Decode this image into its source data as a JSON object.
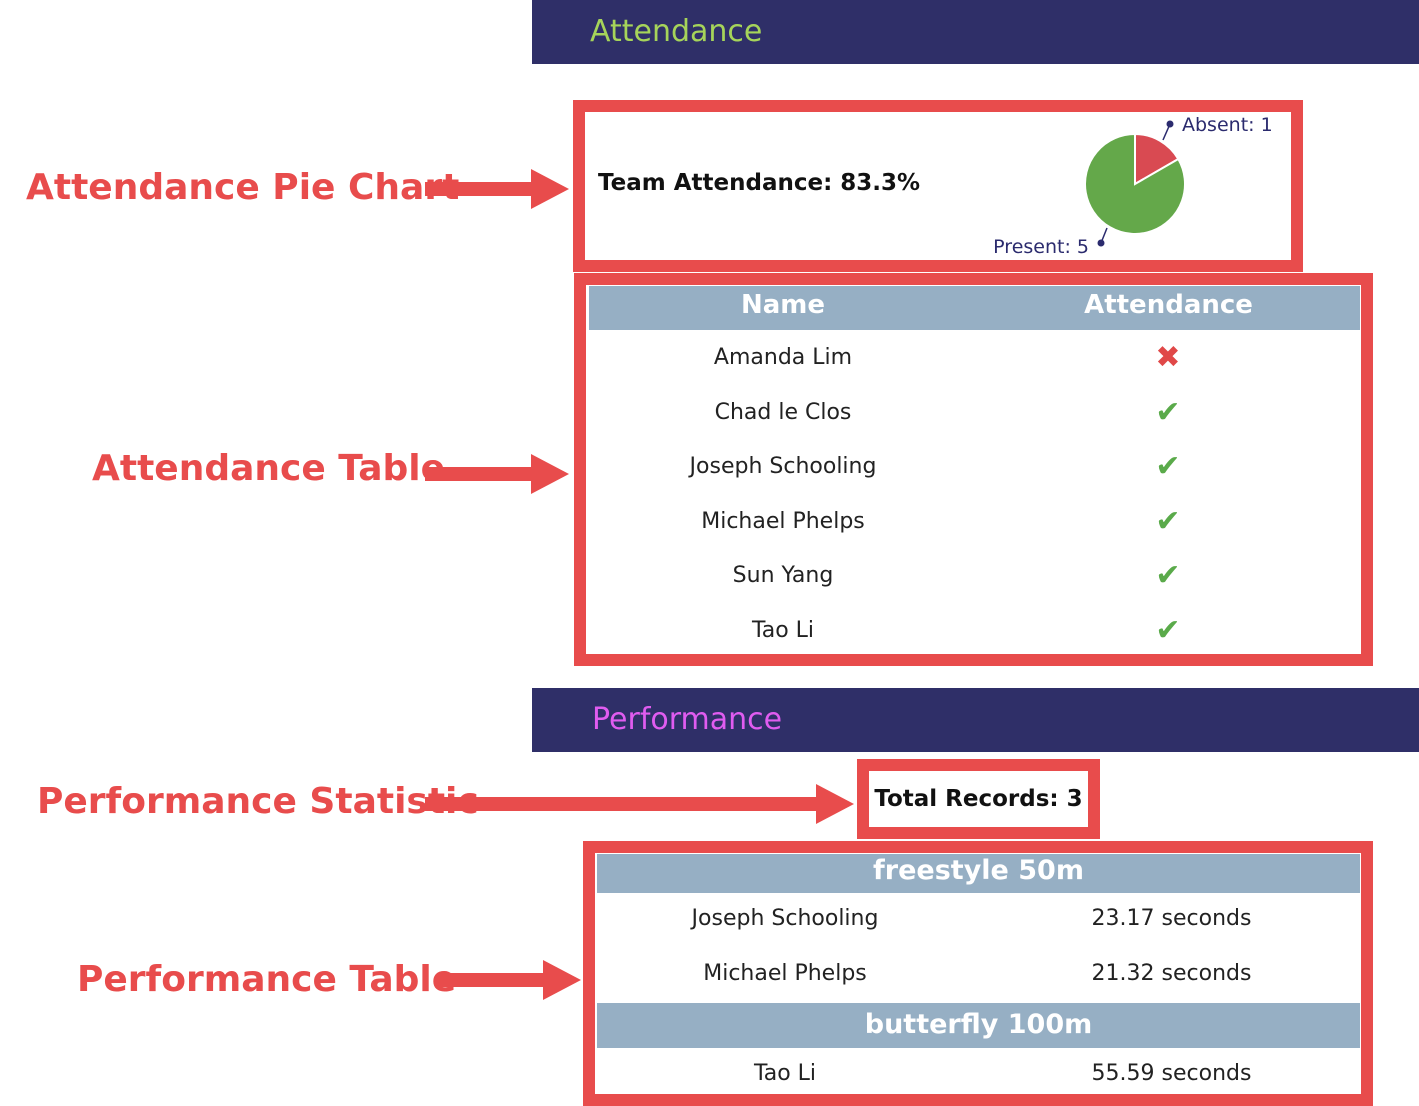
{
  "attendance_section": {
    "title": "Attendance",
    "title_color": "#a6d45a",
    "header_bg": "#2f2f68"
  },
  "performance_section": {
    "title": "Performance",
    "title_color": "#e05cf0",
    "header_bg": "#2f2f68"
  },
  "callouts": {
    "pie_chart": "Attendance Pie Chart",
    "attendance_table": "Attendance Table",
    "performance_statistic": "Performance Statistic",
    "performance_table": "Performance Table",
    "color": "#e84c4c"
  },
  "attendance_summary": {
    "team_attendance": "Team Attendance: 83.3%"
  },
  "chart_data": {
    "type": "pie",
    "slices": [
      {
        "label": "Absent",
        "value": 1,
        "color": "#d94a52",
        "text": "Absent: 1"
      },
      {
        "label": "Present",
        "value": 5,
        "color": "#64a84a",
        "text": "Present: 5"
      }
    ]
  },
  "attendance_table": {
    "headers": {
      "name": "Name",
      "attendance": "Attendance"
    },
    "rows": [
      {
        "name": "Amanda Lim",
        "status": "absent",
        "icon": "cross-icon"
      },
      {
        "name": "Chad le Clos",
        "status": "present",
        "icon": "check-icon"
      },
      {
        "name": "Joseph Schooling",
        "status": "present",
        "icon": "check-icon"
      },
      {
        "name": "Michael Phelps",
        "status": "present",
        "icon": "check-icon"
      },
      {
        "name": "Sun Yang",
        "status": "present",
        "icon": "check-icon"
      },
      {
        "name": "Tao Li",
        "status": "present",
        "icon": "check-icon"
      }
    ],
    "present_color": "#5aaa4a",
    "absent_color": "#e04848"
  },
  "performance_stat": {
    "total_records": "Total Records: 3"
  },
  "performance_table": {
    "groups": [
      {
        "event": "freestyle 50m",
        "records": [
          {
            "name": "Joseph Schooling",
            "time": "23.17 seconds"
          },
          {
            "name": "Michael Phelps",
            "time": "21.32 seconds"
          }
        ]
      },
      {
        "event": "butterfly 100m",
        "records": [
          {
            "name": "Tao Li",
            "time": "55.59 seconds"
          }
        ]
      }
    ]
  }
}
